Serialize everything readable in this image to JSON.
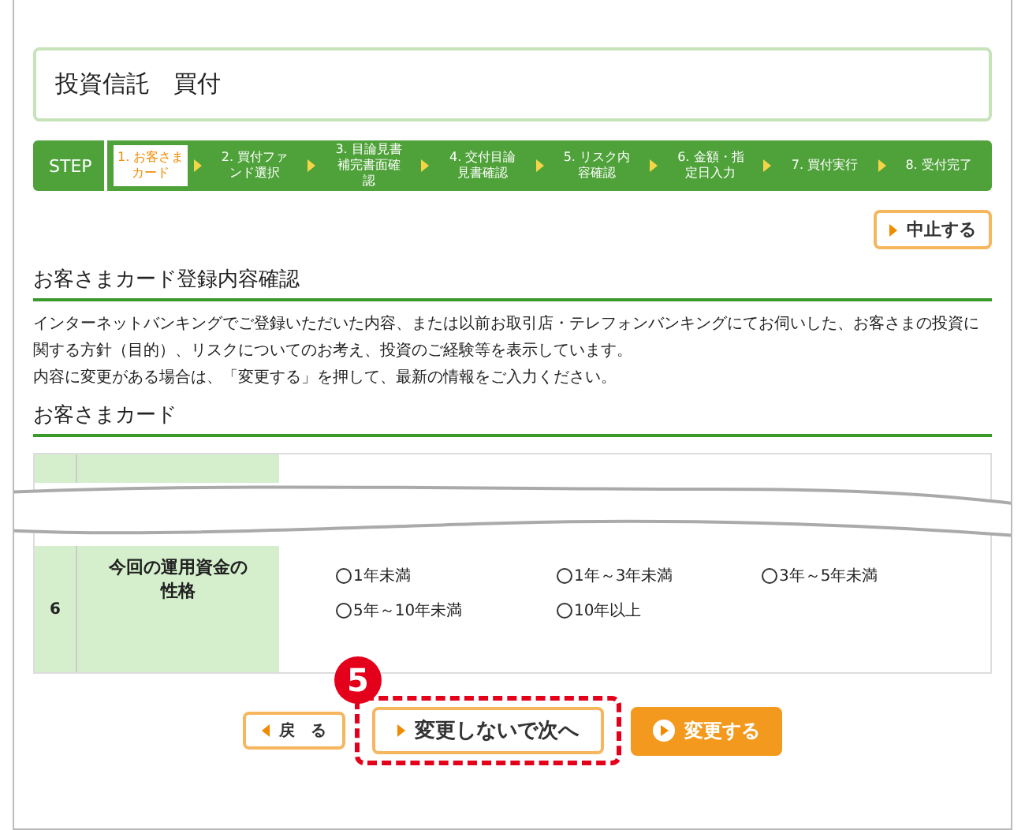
{
  "page_title": "投資信託　買付",
  "steps": {
    "label": "STEP",
    "items": [
      {
        "text": "1. お客さまカード",
        "selected": true
      },
      {
        "text": "2. 買付ファンド選択",
        "selected": false
      },
      {
        "text": "3. 目論見書補完書面確認",
        "selected": false
      },
      {
        "text": "4. 交付目論見書確認",
        "selected": false
      },
      {
        "text": "5. リスク内容確認",
        "selected": false
      },
      {
        "text": "6. 金額・指定日入力",
        "selected": false
      },
      {
        "text": "7. 買付実行",
        "selected": false
      },
      {
        "text": "8. 受付完了",
        "selected": false
      }
    ]
  },
  "cancel_button": "中止する",
  "heading": "お客さまカード登録内容確認",
  "description": [
    "インターネットバンキングでご登録いただいた内容、または以前お取引店・テレフォンバンキングにてお伺いした、お客さまの投資に関する方針（目的）、リスクについてのお考え、投資のご経験等を表示しています。",
    "内容に変更がある場合は、「変更する」を押して、最新の情報をご入力ください。"
  ],
  "card_heading": "お客さまカード",
  "row": {
    "number": "6",
    "label": "今回の運用資金の性格",
    "options": [
      {
        "text": "1年未満",
        "selected": false
      },
      {
        "text": "1年～3年未満",
        "selected": false
      },
      {
        "text": "3年～5年未満",
        "selected": false
      },
      {
        "text": "5年～10年未満",
        "selected": false
      },
      {
        "text": "10年以上",
        "selected": false
      }
    ]
  },
  "buttons": {
    "back": "戻　る",
    "next": "変更しないで次へ",
    "change": "変更する"
  },
  "callout": "5"
}
